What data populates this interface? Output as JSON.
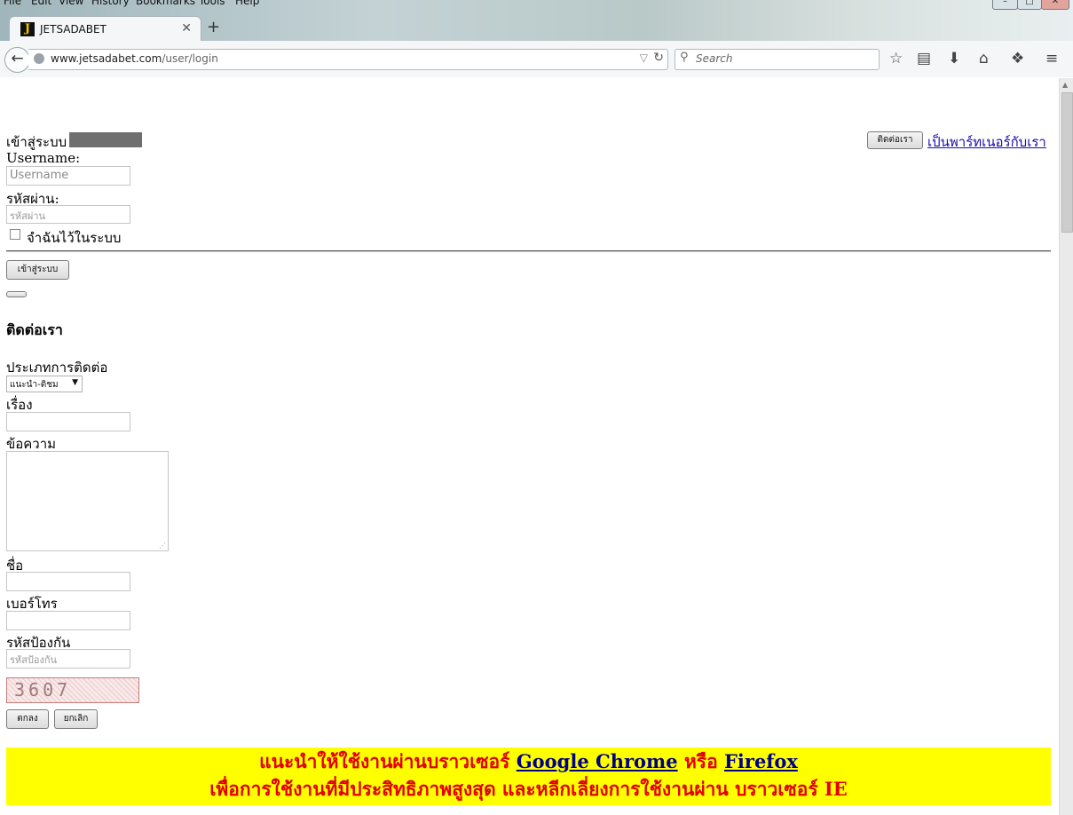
{
  "browser": {
    "menu": [
      "File",
      "Edit",
      "View",
      "History",
      "Bookmarks",
      "Tools",
      "Help"
    ],
    "tab_title": "JETSADABET",
    "tab_favicon": "J",
    "url_domain": "www.jetsadabet.com",
    "url_path": "/user/login",
    "search_placeholder": "Search",
    "window_buttons": {
      "minimize": "–",
      "maximize": "□",
      "close": "✕"
    }
  },
  "login": {
    "title": "เข้าสู่ระบบ",
    "username_label": "Username:",
    "username_placeholder": "Username",
    "password_label": "รหัสผ่าน:",
    "password_placeholder": "รหัสผ่าน",
    "remember_label": "จำฉันไว้ในระบบ",
    "remember_checked": false,
    "submit_label": "เข้าสู่ระบบ",
    "contact_button": "ติดต่อเรา",
    "partner_link": "เป็นพาร์ทเนอร์กับเรา"
  },
  "contact": {
    "heading": "ติดต่อเรา",
    "type_label": "ประเภทการติดต่อ",
    "type_selected": "แนะนำ-ติชม",
    "subject_label": "เรื่อง",
    "message_label": "ข้อความ",
    "name_label": "ชื่อ",
    "phone_label": "เบอร์โทร",
    "captcha_label": "รหัสป้องกัน",
    "captcha_placeholder": "รหัสป้องกัน",
    "captcha_code": "3607",
    "ok_label": "ตกลง",
    "cancel_label": "ยกเลิก"
  },
  "notice": {
    "line1_prefix": "แนะนำให้ใช้งานผ่านบราวเซอร์",
    "chrome_link": "Google Chrome",
    "or_text": "หรือ",
    "firefox_link": "Firefox",
    "line2": "เพื่อการใช้งานที่มีประสิทธิภาพสูงสุด และหลีกเลี่ยงการใช้งานผ่าน บราวเซอร์ IE"
  },
  "colors": {
    "notice_bg": "#ffff00",
    "notice_text": "#e30000",
    "link": "#00008b"
  }
}
